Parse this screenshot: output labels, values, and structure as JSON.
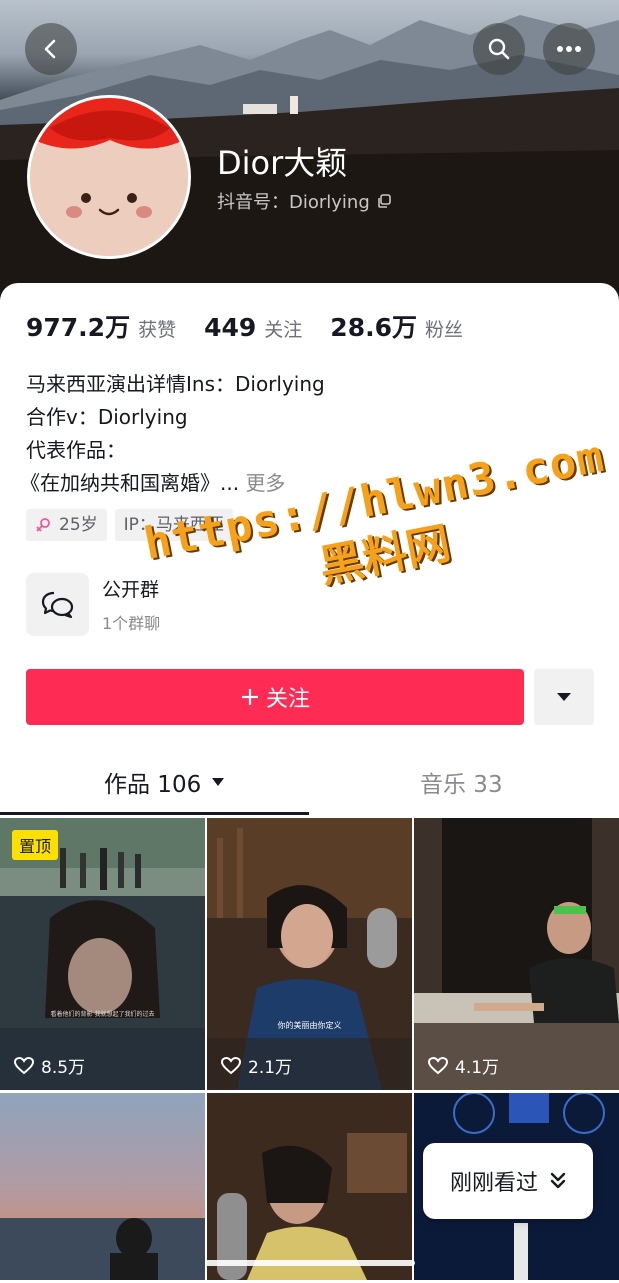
{
  "profile": {
    "name": "Dior大颖",
    "douyin_id_label": "抖音号：Diorlying"
  },
  "stats": [
    {
      "value": "977.2万",
      "label": "获赞"
    },
    {
      "value": "449",
      "label": "关注"
    },
    {
      "value": "28.6万",
      "label": "粉丝"
    }
  ],
  "bio": {
    "line1": "马来西亚演出详情Ins：Diorlying",
    "line2": "合作v：Diorlying",
    "line3": "代表作品：",
    "line4": "《在加纳共和国离婚》...",
    "more": "更多"
  },
  "tags": {
    "age": "25岁",
    "ip": "IP：马来西亚"
  },
  "group": {
    "title": "公开群",
    "subtitle": "1个群聊"
  },
  "follow_label": "关注",
  "tabs": {
    "works": "作品 106",
    "music": "音乐 33"
  },
  "videos": [
    {
      "likes": "8.5万",
      "pinned_label": "置顶",
      "caption": "看着他们的背影 我就想起了我们的过去"
    },
    {
      "likes": "2.1万",
      "caption": "你的美丽由你定义"
    },
    {
      "likes": "4.1万"
    }
  ],
  "watermark": {
    "url": "https://hlwn3.com",
    "site": "黑料网"
  },
  "recent_label": "刚刚看过",
  "colors": {
    "accent": "#fe2c55",
    "pin": "#fbe000",
    "watermark": "#f6a11a"
  }
}
